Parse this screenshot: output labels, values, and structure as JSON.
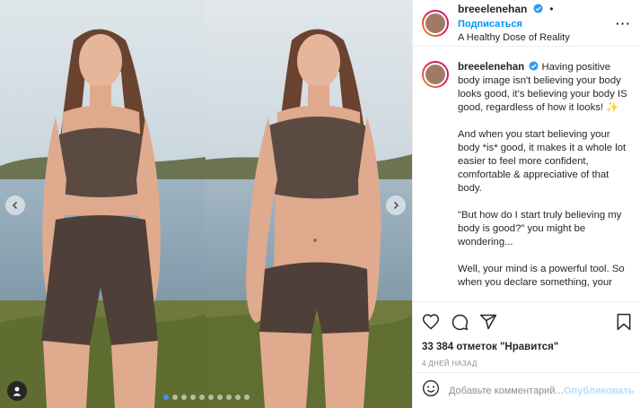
{
  "post": {
    "username": "breeelenehan",
    "follow_label": "Подписаться",
    "location": "A Healthy Dose of Reality",
    "more_icon": "more-horizontal-icon",
    "verified_icon": "verified-badge-icon",
    "caption": {
      "first": "Having positive body image isn't believing your body looks good, it's believing your body IS good, regardless of how it looks! ✨",
      "p2": "And when you start believing your body *is* good, it makes it a whole lot easier to feel more confident, comfortable & appreciative of that body.",
      "p3": "\"But how do I start truly believing my body is good?\" you might be wondering...",
      "p4": "Well, your mind is a powerful tool. So when you declare something, your brain looks for evidence to confirm it. So if you declare: \"I'm not good enough\", your brain is going to seek everything in your"
    },
    "likes": "33 384 отметок \"Нравится\"",
    "time": "4 ДНЕЙ НАЗАД",
    "comment_placeholder": "Добавьте комментарий...",
    "publish_label": "Опубликовать"
  },
  "carousel": {
    "slide_count": 10,
    "active_index": 0
  },
  "colors": {
    "accent": "#0095f6",
    "active_dot": "#3897f0",
    "publish_disabled": "#b2dffc"
  }
}
